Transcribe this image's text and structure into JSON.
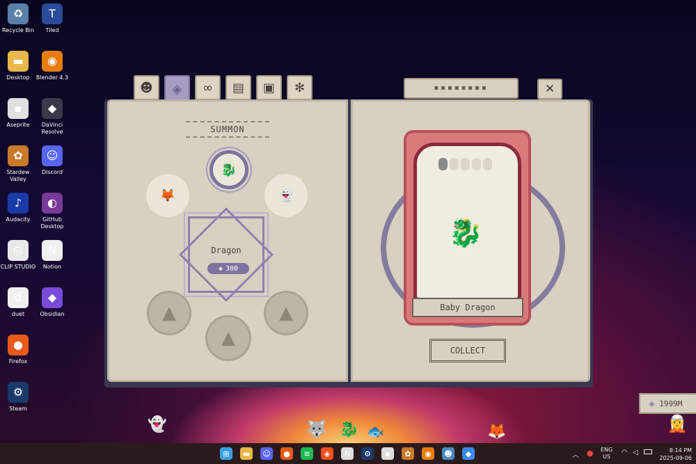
{
  "desktop": {
    "icons": [
      {
        "label": "Recycle Bin",
        "icon": "recycle-bin-icon",
        "glyph": "♻",
        "color": "#5a7fa8"
      },
      {
        "label": "Tiled",
        "icon": "tiled-icon",
        "glyph": "T",
        "color": "#2a4a9a"
      },
      {
        "label": "Desktop",
        "icon": "folder-icon",
        "glyph": "▬",
        "color": "#e8b84a"
      },
      {
        "label": "Blender 4.3",
        "icon": "blender-icon",
        "glyph": "◉",
        "color": "#e87d0d"
      },
      {
        "label": "Aseprite",
        "icon": "aseprite-icon",
        "glyph": "▪",
        "color": "#e0e0e0"
      },
      {
        "label": "DaVinci Resolve",
        "icon": "davinci-icon",
        "glyph": "◆",
        "color": "#3a3a4a"
      },
      {
        "label": "Stardew Valley",
        "icon": "stardew-icon",
        "glyph": "✿",
        "color": "#c87a2a"
      },
      {
        "label": "Discord",
        "icon": "discord-icon",
        "glyph": "☺",
        "color": "#5865f2"
      },
      {
        "label": "Audacity",
        "icon": "audacity-icon",
        "glyph": "♪",
        "color": "#1a3aa8"
      },
      {
        "label": "GitHub Desktop",
        "icon": "github-icon",
        "glyph": "◐",
        "color": "#7a3a9a"
      },
      {
        "label": "CLIP STUDIO",
        "icon": "clip-studio-icon",
        "glyph": "◎",
        "color": "#e8e8e8"
      },
      {
        "label": "Notion",
        "icon": "notion-icon",
        "glyph": "N",
        "color": "#f0f0f0"
      },
      {
        "label": "duet",
        "icon": "duet-icon",
        "glyph": "d",
        "color": "#f0f0f0"
      },
      {
        "label": "Obsidian",
        "icon": "obsidian-icon",
        "glyph": "◆",
        "color": "#7a4ad8"
      },
      {
        "label": "Firefox",
        "icon": "firefox-icon",
        "glyph": "●",
        "color": "#e85a1a"
      },
      {
        "label": "Steam",
        "icon": "steam-icon",
        "glyph": "⚙",
        "color": "#1a3a6a"
      }
    ]
  },
  "book": {
    "tabs": [
      {
        "icon": "monster-icon",
        "glyph": "☻"
      },
      {
        "icon": "summon-icon",
        "glyph": "◈"
      },
      {
        "icon": "skills-icon",
        "glyph": "∞"
      },
      {
        "icon": "book-icon",
        "glyph": "▤"
      },
      {
        "icon": "inventory-icon",
        "glyph": "▣"
      },
      {
        "icon": "settings-icon",
        "glyph": "✻"
      }
    ],
    "left": {
      "title": "SUMMON",
      "selected_name": "Dragon",
      "cost": "300"
    },
    "right": {
      "creature_name": "Baby Dragon",
      "collect_label": "COLLECT",
      "level_dots": 5,
      "filled_dots": 1,
      "close_glyph": "✕"
    }
  },
  "currency": {
    "amount": "1999M"
  },
  "taskbar": {
    "apps": [
      {
        "icon": "windows-start-icon",
        "glyph": "⊞",
        "color": "#3aa0e8"
      },
      {
        "icon": "file-explorer-icon",
        "glyph": "▬",
        "color": "#e8b84a"
      },
      {
        "icon": "discord-icon",
        "glyph": "☺",
        "color": "#5865f2"
      },
      {
        "icon": "firefox-icon",
        "glyph": "●",
        "color": "#e85a1a"
      },
      {
        "icon": "spotify-icon",
        "glyph": "≋",
        "color": "#1db954"
      },
      {
        "icon": "figma-icon",
        "glyph": "◈",
        "color": "#f24e1e"
      },
      {
        "icon": "notion-icon",
        "glyph": "N",
        "color": "#ddd"
      },
      {
        "icon": "steam-icon",
        "glyph": "⚙",
        "color": "#1a3a6a"
      },
      {
        "icon": "aseprite-icon",
        "glyph": "▪",
        "color": "#ddd"
      },
      {
        "icon": "stardew-icon",
        "glyph": "✿",
        "color": "#c87a2a"
      },
      {
        "icon": "blender-icon",
        "glyph": "◉",
        "color": "#e87d0d"
      },
      {
        "icon": "godot-icon",
        "glyph": "☻",
        "color": "#478cbf"
      },
      {
        "icon": "game-icon",
        "glyph": "◆",
        "color": "#3a8ae8"
      }
    ],
    "lang": "ENG",
    "region": "US",
    "time": "8:14 PM",
    "date": "2025-09-06"
  }
}
